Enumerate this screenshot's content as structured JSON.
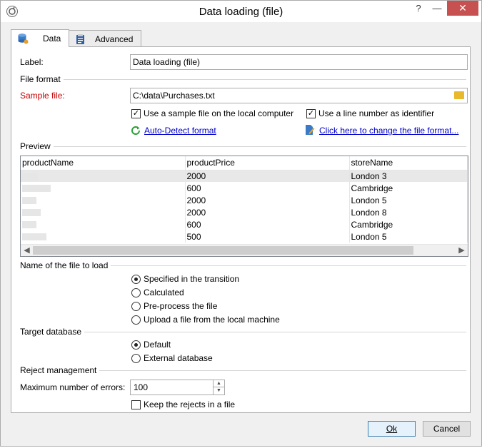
{
  "window": {
    "title": "Data loading (file)",
    "help_label": "?",
    "minimize_label": "—",
    "close_label": "✕"
  },
  "tabs": [
    {
      "label": "Data",
      "icon": "database-icon",
      "active": true
    },
    {
      "label": "Advanced",
      "icon": "clipboard-icon",
      "active": false
    }
  ],
  "label_field": {
    "label": "Label:",
    "value": "Data loading (file)"
  },
  "file_format": {
    "section": "File format",
    "sample_file_label": "Sample file:",
    "sample_file_value": "C:\\data\\Purchases.txt",
    "use_local_label": "Use a sample file on the local computer",
    "use_local_checked": true,
    "line_number_label": "Use a line number as identifier",
    "line_number_checked": true,
    "auto_detect_label": "Auto-Detect format",
    "change_format_label": "Click here to change the file format..."
  },
  "preview": {
    "section": "Preview",
    "columns": [
      "productName",
      "productPrice",
      "storeName"
    ],
    "rows": [
      {
        "price": "2000",
        "store": "London 3"
      },
      {
        "price": "600",
        "store": "Cambridge"
      },
      {
        "price": "2000",
        "store": "London 5"
      },
      {
        "price": "2000",
        "store": "London 8"
      },
      {
        "price": "600",
        "store": "Cambridge"
      },
      {
        "price": "500",
        "store": "London 5"
      }
    ],
    "scroll_left": "◀",
    "scroll_right": "▶"
  },
  "file_to_load": {
    "section": "Name of the file to load",
    "options": [
      {
        "label": "Specified in the transition",
        "selected": true
      },
      {
        "label": "Calculated",
        "selected": false
      },
      {
        "label": "Pre-process the file",
        "selected": false
      },
      {
        "label": "Upload a file from the local machine",
        "selected": false
      }
    ]
  },
  "target_database": {
    "section": "Target database",
    "options": [
      {
        "label": "Default",
        "selected": true
      },
      {
        "label": "External database",
        "selected": false
      }
    ]
  },
  "reject": {
    "section": "Reject management",
    "max_errors_label": "Maximum number of errors:",
    "max_errors_value": "100",
    "keep_rejects_label": "Keep the rejects in a file",
    "keep_rejects_checked": false
  },
  "buttons": {
    "ok": "Ok",
    "cancel": "Cancel"
  },
  "colors": {
    "accent": "#3c7fb1",
    "required": "#c40000",
    "link": "#0000cc"
  }
}
